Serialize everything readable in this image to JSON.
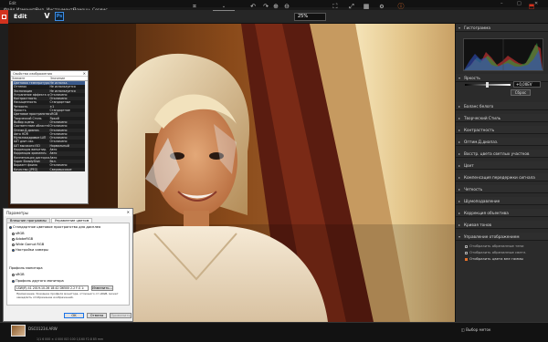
{
  "window": {
    "title": "Edit",
    "minimize": "–",
    "maximize": "□",
    "close": "✕"
  },
  "menu": [
    "Файл",
    "Изменить",
    "Вид",
    "Инструменты",
    "Помощь",
    "Сервис"
  ],
  "toolbar": {
    "mode_label": "Edit",
    "zoom": "25%",
    "mode_ps": "Ps",
    "mode_v": "V"
  },
  "dialog_props": {
    "title": "Свойства изображения",
    "close": "✕",
    "col_element": "Элемент",
    "col_value": "Значение",
    "rows": [
      [
        "Цветовая температура",
        "Не использ."
      ],
      [
        "Оттенок",
        "Не используется"
      ],
      [
        "Экспозиция",
        "Не используется"
      ],
      [
        "Устранение эффекта ср.",
        "Отключено"
      ],
      [
        "Контрастность",
        "Отключено"
      ],
      [
        "Насыщенность",
        "Стандартные"
      ],
      [
        "Четкость",
        "±1"
      ],
      [
        "Яркость",
        "Стандартное"
      ],
      [
        "Цветовое пространство",
        "sRGB"
      ],
      [
        "Творческий Стиль",
        "Яркий"
      ],
      [
        "Выбор сцены",
        "Отключено"
      ],
      [
        "Соответствие областей",
        "Отключено"
      ],
      [
        "Оптим.Д.диапаз.",
        "Отключено"
      ],
      [
        "Авто HDR",
        "Отключено"
      ],
      [
        "Мультикадровое ШП",
        "Отключено"
      ],
      [
        "ШП длит.экс.",
        "Отключено"
      ],
      [
        "ШП высокого ISO",
        "Нормальный"
      ],
      [
        "Коррекция виньетир.",
        "Авто"
      ],
      [
        "Коррекция хроматич.",
        "Авто"
      ],
      [
        "Компенсация дисторсии",
        "Авто"
      ],
      [
        "Super SteadyShot",
        "Вкл."
      ],
      [
        "Вариант фаила",
        "Отключено"
      ],
      [
        "Качество (JPEG)",
        "Сверхвысокое"
      ]
    ]
  },
  "dialog_settings": {
    "title": "Параметры",
    "close": "✕",
    "tabs": [
      "Внешние программы",
      "Управление цветом"
    ],
    "group_label": "Стандартное цветовое пространство для дисплея",
    "options": [
      "sRGB",
      "AdobeRGB",
      "Wide Gamut RGB",
      "Настройки камеры"
    ],
    "profile_label": "Профиль монитора",
    "profile_options": [
      "sRGB",
      "Профиль другого монитора"
    ],
    "profile_value": "LSW(R) 41 2019-10-26 18:42 D6500 2.2 F-S 1:",
    "change_button": "Изменить...",
    "note": "Примечание. Указание профиля монитора, отличного от sRGB, может замедлить отображение изображений.",
    "ok": "OK",
    "cancel": "Отмена",
    "apply": "Применить"
  },
  "right_panel": {
    "histogram_label": "Гистограмма",
    "brightness_label": "Яркость",
    "brightness_value": "+0,00EV",
    "reset_button": "Сброс",
    "sections": [
      "Баланс белого",
      "Творческий Стиль",
      "Контрастность",
      "Оптим.Д.диапаз.",
      "Восстр. цвета светлых участков",
      "Цвет",
      "Компенсация передержки сигнала",
      "Четкость",
      "Шумоподавление",
      "Коррекция объектива",
      "Кривая тонов"
    ],
    "display_control": {
      "label": "Управление отображением",
      "options": [
        "Отобразить обрезанные тени",
        "Отобразить обрезанные светл.",
        "Отобразить цвета вне гаммы"
      ],
      "checked": [
        false,
        false,
        true
      ]
    }
  },
  "filmstrip": {
    "thumb_name": "DSC01234.ARW",
    "status": "1/1   6 000 × 4 000   ISO 100   1/160   F2.8   85 mm",
    "tag_select": "Выбор меток"
  },
  "colors": {
    "accent": "#e5702a",
    "brand": "#d2321e",
    "ps_blue": "#3c8ee8"
  }
}
